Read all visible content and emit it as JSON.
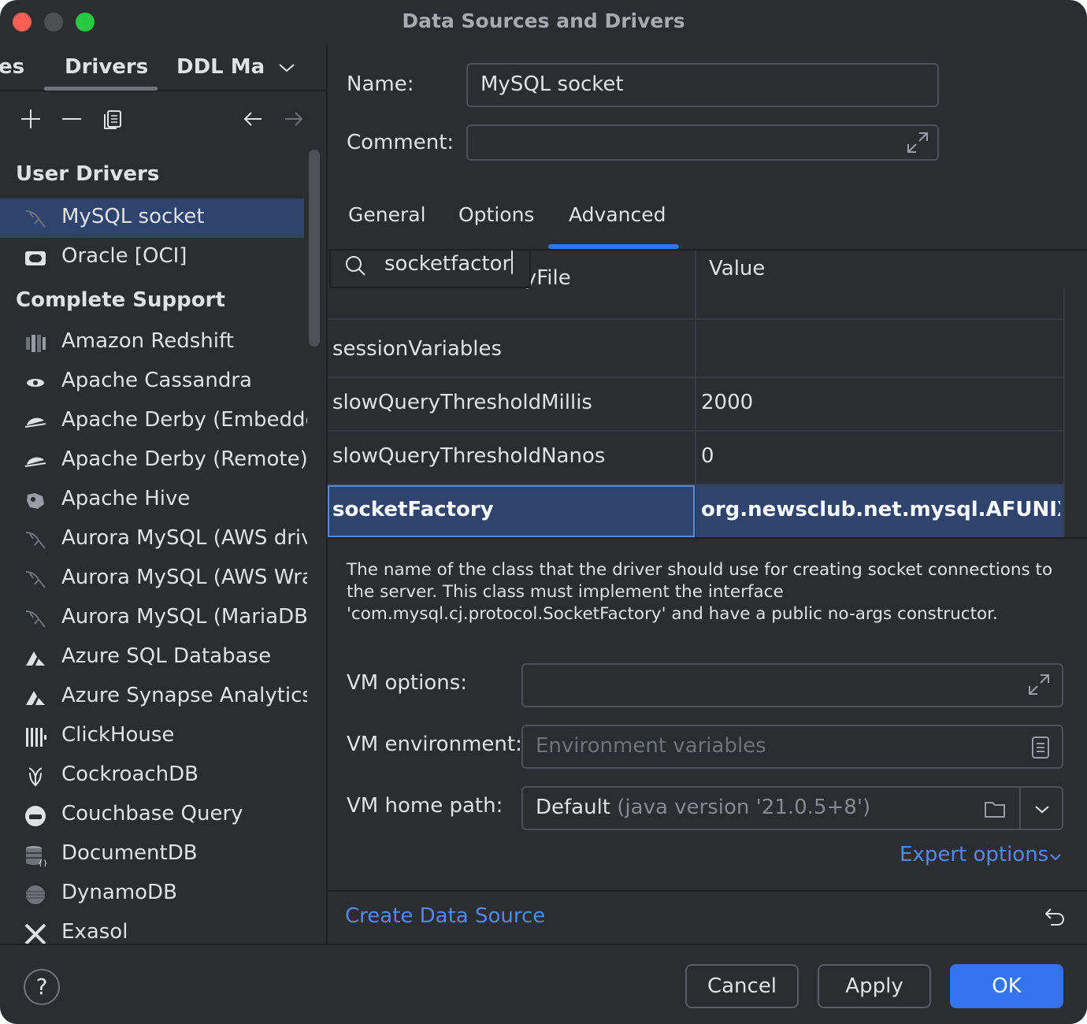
{
  "window": {
    "title": "Data Sources and Drivers"
  },
  "left_tabs": {
    "partial_prev": "es",
    "drivers": "Drivers",
    "ddl": "DDL Map"
  },
  "toolbar": {
    "icons": [
      "add-icon",
      "remove-icon",
      "duplicate-icon",
      "back-icon",
      "forward-icon"
    ]
  },
  "user_drivers": {
    "heading": "User Drivers",
    "items": [
      {
        "label": "MySQL socket",
        "icon": "dolphin-icon",
        "selected": true
      },
      {
        "label": "Oracle [OCI]",
        "icon": "oracle-icon",
        "selected": false
      }
    ]
  },
  "complete_support": {
    "heading": "Complete Support",
    "items": [
      {
        "label": "Amazon Redshift",
        "icon": "redshift-icon"
      },
      {
        "label": "Apache Cassandra",
        "icon": "cassandra-icon"
      },
      {
        "label": "Apache Derby (Embedde",
        "icon": "derby-icon"
      },
      {
        "label": "Apache Derby (Remote)",
        "icon": "derby-icon"
      },
      {
        "label": "Apache Hive",
        "icon": "hive-icon"
      },
      {
        "label": "Aurora MySQL (AWS driv",
        "icon": "dolphin-icon"
      },
      {
        "label": "Aurora MySQL (AWS Wra",
        "icon": "dolphin-icon"
      },
      {
        "label": "Aurora MySQL (MariaDB",
        "icon": "dolphin-icon"
      },
      {
        "label": "Azure SQL Database",
        "icon": "azure-icon"
      },
      {
        "label": "Azure Synapse Analytics",
        "icon": "azure-icon"
      },
      {
        "label": "ClickHouse",
        "icon": "clickhouse-icon"
      },
      {
        "label": "CockroachDB",
        "icon": "cockroach-icon"
      },
      {
        "label": "Couchbase Query",
        "icon": "couchbase-icon"
      },
      {
        "label": "DocumentDB",
        "icon": "documentdb-icon"
      },
      {
        "label": "DynamoDB",
        "icon": "dynamodb-icon"
      },
      {
        "label": "Exasol",
        "icon": "exasol-icon"
      }
    ]
  },
  "form": {
    "name_label": "Name:",
    "name_value": "MySQL socket",
    "comment_label": "Comment:",
    "comment_value": ""
  },
  "tabs": {
    "general": "General",
    "options": "Options",
    "advanced": "Advanced",
    "active": "Advanced"
  },
  "properties": {
    "search_value": "socketfactor",
    "value_header": "Value",
    "rows": [
      {
        "name": "serverRSAPublicKeyFile",
        "value": ""
      },
      {
        "name": "sessionVariables",
        "value": ""
      },
      {
        "name": "slowQueryThresholdMillis",
        "value": "2000"
      },
      {
        "name": "slowQueryThresholdNanos",
        "value": "0"
      },
      {
        "name": "socketFactory",
        "value": "org.newsclub.net.mysql.AFUNIXD...",
        "selected": true
      }
    ]
  },
  "description": "The name of the class that the driver should use for creating socket connections to the server. This class must implement the interface 'com.mysql.cj.protocol.SocketFactory' and have a public no-args constructor.",
  "vm": {
    "options_label": "VM options:",
    "options_value": "",
    "env_label": "VM environment:",
    "env_placeholder": "Environment variables",
    "home_label": "VM home path:",
    "home_value": "Default",
    "home_hint": "(java version '21.0.5+8')"
  },
  "links": {
    "expert_options": "Expert options",
    "create_data_source": "Create Data Source"
  },
  "buttons": {
    "help": "?",
    "cancel": "Cancel",
    "apply": "Apply",
    "ok": "OK"
  },
  "colors": {
    "background": "#2b2d30",
    "selection": "#2e436e",
    "accent": "#3574f0",
    "link": "#548af7"
  }
}
